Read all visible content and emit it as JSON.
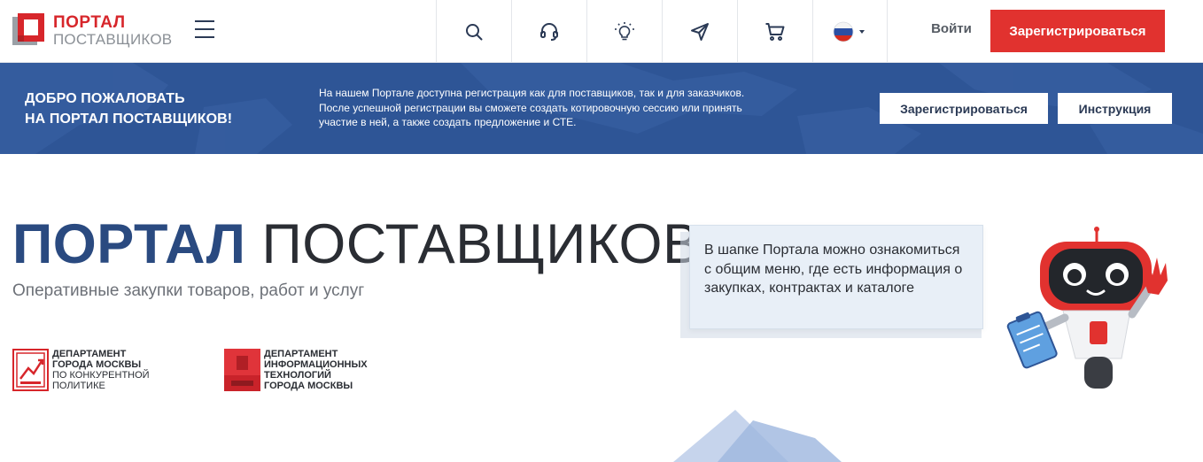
{
  "header": {
    "logo": {
      "line1": "ПОРТАЛ",
      "line2": "ПОСТАВЩИКОВ"
    },
    "menu_icon": "hamburger-icon",
    "tools": [
      {
        "name": "search",
        "icon": "search-icon"
      },
      {
        "name": "support",
        "icon": "headset-icon"
      },
      {
        "name": "ideas",
        "icon": "lightbulb-icon"
      },
      {
        "name": "send",
        "icon": "paper-plane-icon"
      },
      {
        "name": "cart",
        "icon": "cart-icon"
      },
      {
        "name": "language",
        "icon": "russia-flag-icon"
      }
    ],
    "login_label": "Войти",
    "register_label": "Зарегистрироваться"
  },
  "banner": {
    "welcome_line1": "ДОБРО ПОЖАЛОВАТЬ",
    "welcome_line2": "НА ПОРТАЛ ПОСТАВЩИКОВ!",
    "desc_line1": "На нашем Портале доступна регистрация как для поставщиков, так и для заказчиков.",
    "desc_line2": "После успешной регистрации вы сможете создать котировочную сессию или принять",
    "desc_line3": "участие в ней, а также создать предложение и СТЕ.",
    "register_label": "Зарегистрироваться",
    "instruction_label": "Инструкция"
  },
  "hero": {
    "title_strong": "ПОРТАЛ",
    "title_light": "ПОСТАВЩИКОВ",
    "subtitle": "Оперативные закупки товаров, работ и услуг"
  },
  "departments": [
    {
      "lines_bold": [
        "Департамент",
        "города Москвы"
      ],
      "lines_normal": [
        "по конкурентной",
        "политике"
      ]
    },
    {
      "lines_bold": [
        "Департамент",
        "информационных",
        "технологий",
        "города Москвы"
      ],
      "lines_normal": []
    }
  ],
  "hint": {
    "text": "В шапке Портала можно ознакомиться с общим меню, где есть информация о закупках, контрактах и каталоге"
  },
  "colors": {
    "brand_red": "#e1322f",
    "brand_blue": "#2e5596",
    "title_blue": "#2a4a80"
  }
}
